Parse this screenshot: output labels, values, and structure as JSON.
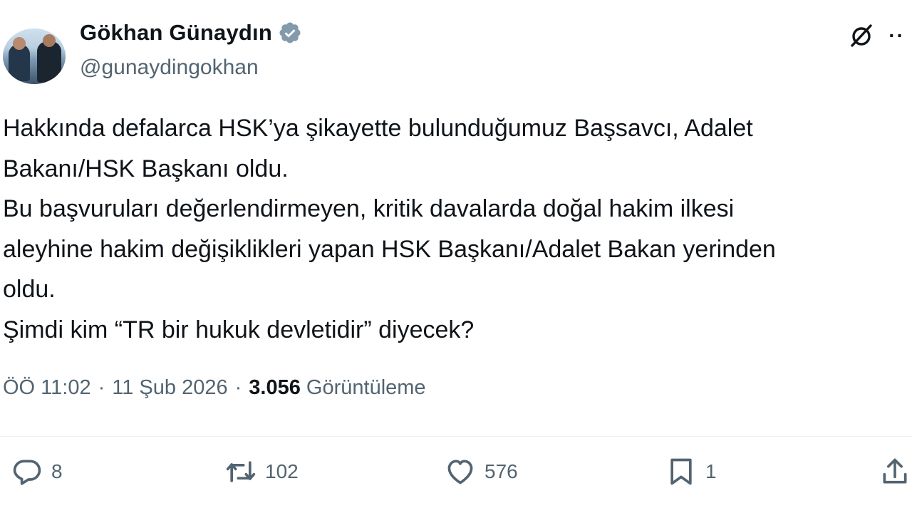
{
  "author": {
    "name": "Gökhan Günaydın",
    "handle": "@gunaydingokhan",
    "avatar_icon": "profile-photo",
    "verified_badge_icon": "verified-badge-icon",
    "badge_color": "#829aab"
  },
  "header_actions": {
    "grok_icon": "grok-icon",
    "more_icon": "more-icon"
  },
  "tweet": {
    "lines": [
      "Hakkında defalarca HSK’ya şikayette bulunduğumuz Başsavcı, Adalet",
      "Bakanı/HSK Başkanı oldu.",
      "Bu başvuruları değerlendirmeyen, kritik davalarda doğal hakim ilkesi",
      "aleyhine hakim değişiklikleri yapan HSK Başkanı/Adalet Bakan yerinden",
      "oldu.",
      "Şimdi kim “TR bir hukuk devletidir” diyecek?"
    ]
  },
  "meta": {
    "time": "ÖÖ 11:02",
    "sep1": "·",
    "date": "11 Şub 2026",
    "sep2": "·",
    "views_count": "3.056",
    "views_label": "Görüntüleme"
  },
  "actions": {
    "reply": {
      "icon": "reply-icon",
      "count": "8"
    },
    "retweet": {
      "icon": "retweet-icon",
      "count": "102"
    },
    "like": {
      "icon": "heart-icon",
      "count": "576"
    },
    "bookmark": {
      "icon": "bookmark-icon",
      "count": "1"
    },
    "share": {
      "icon": "share-icon"
    }
  },
  "colors": {
    "text": "#0f1419",
    "secondary": "#536471",
    "divider": "#eff3f4"
  }
}
